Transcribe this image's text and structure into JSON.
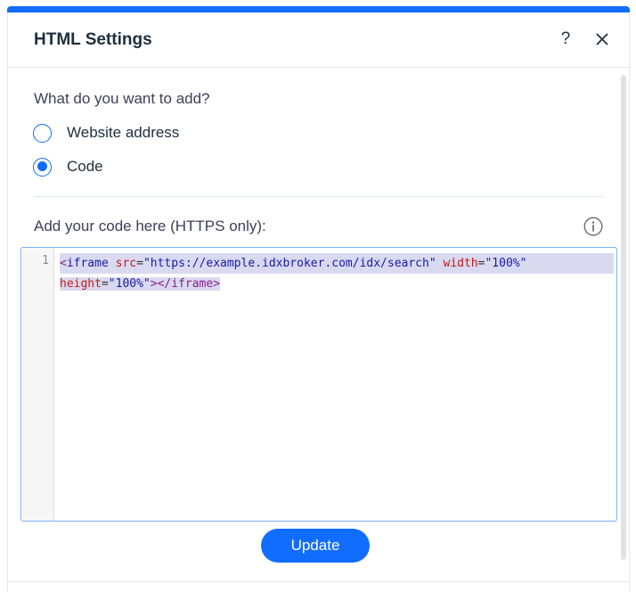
{
  "header": {
    "title": "HTML Settings",
    "help_label": "?"
  },
  "form": {
    "question": "What do you want to add?",
    "options": [
      {
        "label": "Website address",
        "selected": false
      },
      {
        "label": "Code",
        "selected": true
      }
    ],
    "code_label": "Add your code here (HTTPS only):"
  },
  "editor": {
    "line_number": "1",
    "line1": {
      "open_bracket": "<",
      "tag": "iframe",
      "attr_src": "src",
      "val_src": "\"https://example.idxbroker.com/idx/search\"",
      "attr_width": "width",
      "val_width": "\"100%\""
    },
    "line2": {
      "attr_height": "height",
      "val_height": "\"100%\"",
      "close_bracket": ">",
      "close_tag": "</iframe>"
    }
  },
  "actions": {
    "update_label": "Update"
  },
  "colors": {
    "accent": "#116dff",
    "selection": "#d9d9f0"
  },
  "icons": {
    "help": "question-mark-icon",
    "close": "close-icon",
    "info": "info-icon"
  }
}
